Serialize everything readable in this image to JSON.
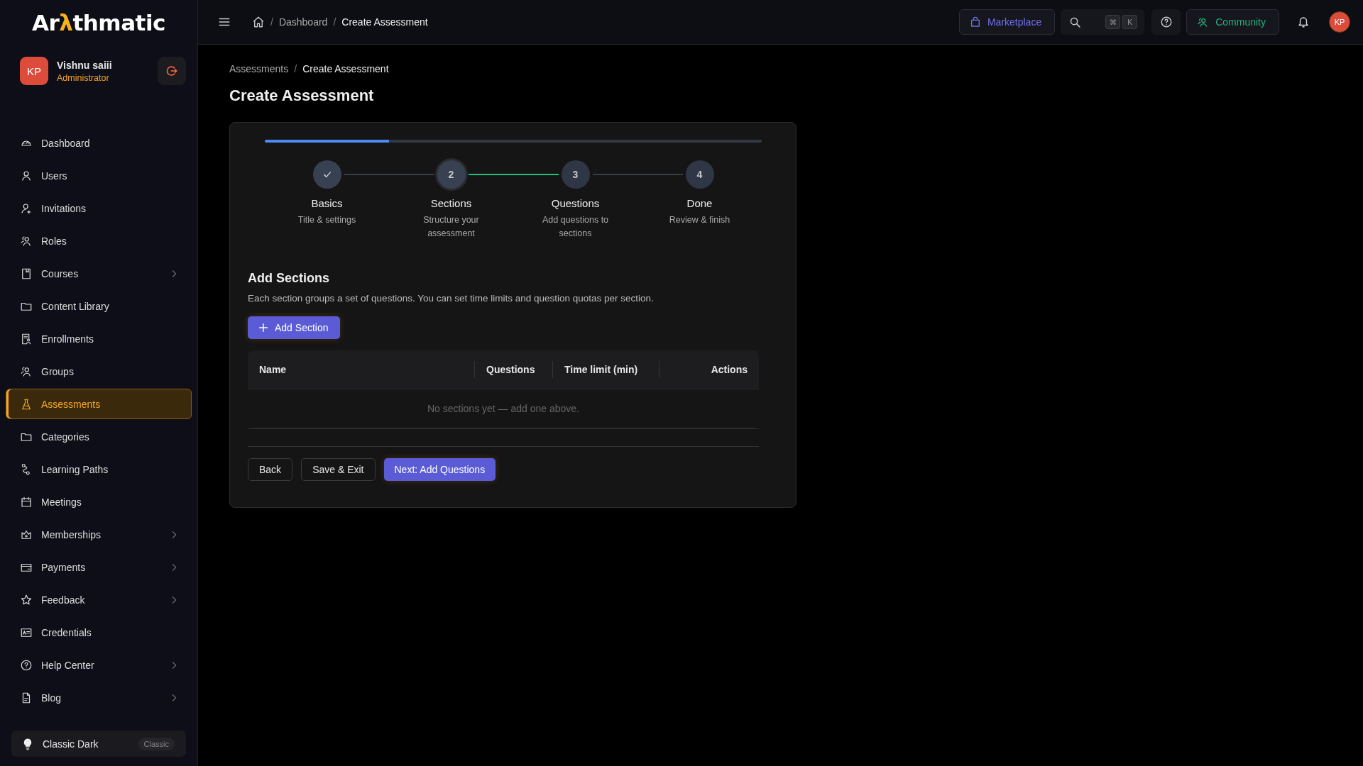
{
  "logo": {
    "before": "Ar",
    "accent": "λ",
    "after": "thmatic"
  },
  "user": {
    "initials": "KP",
    "name": "Vishnu saiii",
    "role": "Administrator"
  },
  "sidebar": {
    "items": [
      {
        "label": "Dashboard",
        "kind": "gauge",
        "expandable": false,
        "selected": false
      },
      {
        "label": "Users",
        "kind": "user",
        "expandable": false,
        "selected": false
      },
      {
        "label": "Invitations",
        "kind": "invite",
        "expandable": false,
        "selected": false
      },
      {
        "label": "Roles",
        "kind": "people",
        "expandable": false,
        "selected": false
      },
      {
        "label": "Courses",
        "kind": "book",
        "expandable": true,
        "selected": false
      },
      {
        "label": "Content Library",
        "kind": "folder",
        "expandable": false,
        "selected": false
      },
      {
        "label": "Enrollments",
        "kind": "enroll",
        "expandable": false,
        "selected": false
      },
      {
        "label": "Groups",
        "kind": "people",
        "expandable": false,
        "selected": false
      },
      {
        "label": "Assessments",
        "kind": "flask",
        "expandable": false,
        "selected": true
      },
      {
        "label": "Categories",
        "kind": "folder",
        "expandable": false,
        "selected": false
      },
      {
        "label": "Learning Paths",
        "kind": "path",
        "expandable": false,
        "selected": false
      },
      {
        "label": "Meetings",
        "kind": "calendar",
        "expandable": false,
        "selected": false
      },
      {
        "label": "Memberships",
        "kind": "crown",
        "expandable": true,
        "selected": false
      },
      {
        "label": "Payments",
        "kind": "card",
        "expandable": true,
        "selected": false
      },
      {
        "label": "Feedback",
        "kind": "star",
        "expandable": true,
        "selected": false
      },
      {
        "label": "Credentials",
        "kind": "id",
        "expandable": false,
        "selected": false
      },
      {
        "label": "Help Center",
        "kind": "help",
        "expandable": true,
        "selected": false
      },
      {
        "label": "Blog",
        "kind": "file",
        "expandable": true,
        "selected": false
      }
    ],
    "theme": {
      "label": "Classic Dark",
      "badge": "Classic"
    }
  },
  "topbar": {
    "breadcrumbs": [
      {
        "separator": "/",
        "label": "Dashboard"
      },
      {
        "separator": "/",
        "label": "Create Assessment"
      }
    ],
    "marketplace": "Marketplace",
    "shortcut_keys": [
      "⌘",
      "K"
    ],
    "community": "Community",
    "avatar": "KP"
  },
  "page": {
    "breadcrumbs": [
      {
        "label": "Assessments"
      },
      {
        "separator": "/",
        "label": "Create Assessment"
      }
    ],
    "title": "Create Assessment"
  },
  "wizard": {
    "progress": {
      "level": 0.25
    },
    "steps": [
      {
        "kind": "done",
        "title": "Basics",
        "subtitle": "Title & settings"
      },
      {
        "kind": "current",
        "number": "2",
        "title": "Sections",
        "subtitle": "Structure your assessment"
      },
      {
        "kind": "upcoming",
        "number": "3",
        "title": "Questions",
        "subtitle": "Add questions to sections"
      },
      {
        "kind": "upcoming",
        "number": "4",
        "title": "Done",
        "subtitle": "Review & finish"
      }
    ],
    "connectors": [
      {
        "highlighted": false
      },
      {
        "highlighted": true
      },
      {
        "highlighted": false
      }
    ],
    "section_title": "Add Sections",
    "description": "Each section groups a set of questions. You can set time limits and question quotas per section.",
    "add_button": "Add Section",
    "table": {
      "columns": [
        "Name",
        "Questions",
        "Time limit (min)",
        "Actions"
      ],
      "empty_message": "No sections yet — add one above."
    },
    "buttons": [
      {
        "label": "Back",
        "kind": "secondary"
      },
      {
        "label": "Save & Exit",
        "kind": "secondary"
      },
      {
        "label": "Next: Add Questions",
        "kind": "primary"
      }
    ]
  }
}
